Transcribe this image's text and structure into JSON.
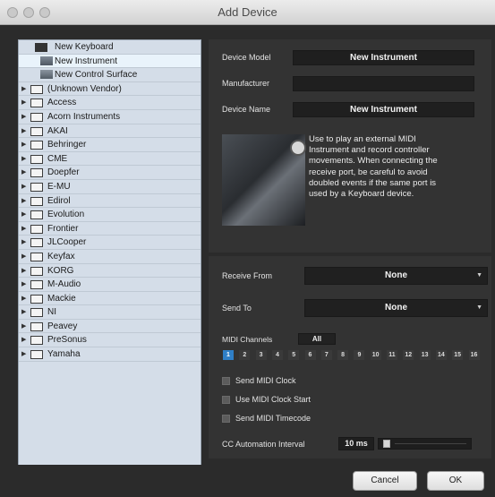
{
  "window": {
    "title": "Add Device"
  },
  "tree": {
    "top_items": [
      {
        "label": "New Keyboard",
        "icon": "keyboard-icon"
      },
      {
        "label": "New Instrument",
        "icon": "instrument-icon",
        "selected": true
      },
      {
        "label": "New Control Surface",
        "icon": "control-surface-icon"
      }
    ],
    "folders": [
      "(Unknown Vendor)",
      "Access",
      "Acorn Instruments",
      "AKAI",
      "Behringer",
      "CME",
      "Doepfer",
      "E-MU",
      "Edirol",
      "Evolution",
      "Frontier",
      "JLCooper",
      "Keyfax",
      "KORG",
      "M-Audio",
      "Mackie",
      "NI",
      "Peavey",
      "PreSonus",
      "Yamaha"
    ]
  },
  "device": {
    "model_label": "Device Model",
    "model_value": "New Instrument",
    "manufacturer_label": "Manufacturer",
    "manufacturer_value": "",
    "name_label": "Device Name",
    "name_value": "New Instrument",
    "description_lines": [
      "Use to play an external MIDI",
      "Instrument and record controller",
      "movements. When connecting the",
      "receive port, be careful to avoid",
      "doubled events if the same port is",
      "used by a Keyboard device."
    ]
  },
  "ports": {
    "receive_label": "Receive From",
    "receive_value": "None",
    "send_label": "Send To",
    "send_value": "None"
  },
  "midi": {
    "channels_label": "MIDI Channels",
    "all_label": "All",
    "channels": [
      "1",
      "2",
      "3",
      "4",
      "5",
      "6",
      "7",
      "8",
      "9",
      "10",
      "11",
      "12",
      "13",
      "14",
      "15",
      "16"
    ],
    "active_channel": "1",
    "send_clock_label": "Send MIDI Clock",
    "use_clock_start_label": "Use MIDI Clock Start",
    "send_timecode_label": "Send MIDI Timecode",
    "cc_interval_label": "CC Automation Interval",
    "cc_interval_value": "10 ms"
  },
  "buttons": {
    "cancel": "Cancel",
    "ok": "OK"
  },
  "colors": {
    "accent": "#2f7fc7",
    "panel": "#333333",
    "tree_bg": "#d4dde8",
    "tree_selected": "#e9f3fb"
  }
}
